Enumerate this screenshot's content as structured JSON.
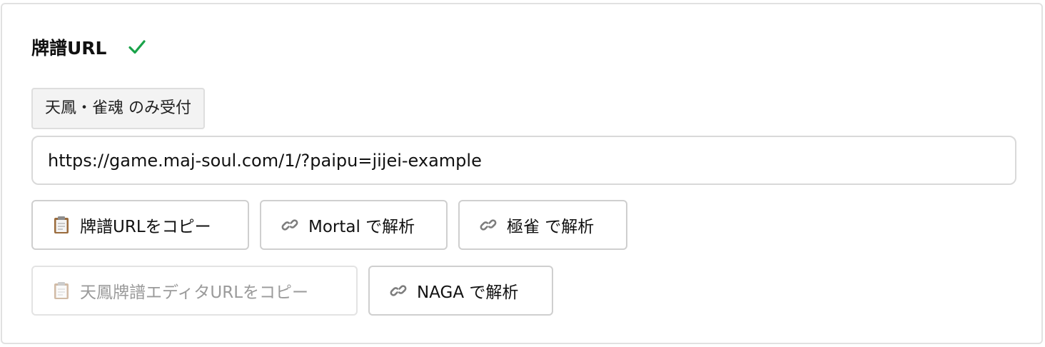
{
  "header": {
    "title": "牌譜URL",
    "valid_icon": "check-icon",
    "valid_color": "#1aa34a"
  },
  "badge": {
    "label": "天鳳・雀魂 のみ受付"
  },
  "url_field": {
    "value": "https://game.maj-soul.com/1/?paipu=jijei-example"
  },
  "actions": {
    "copy_url": {
      "icon": "clipboard-icon",
      "label": "牌譜URLをコピー"
    },
    "mortal": {
      "icon": "link-icon",
      "label": "Mortal で解析"
    },
    "jantama": {
      "icon": "link-icon",
      "label": "極雀 で解析"
    },
    "copy_tenhou_editor": {
      "icon": "clipboard-icon",
      "label": "天鳳牌譜エディタURLをコピー",
      "disabled": true
    },
    "naga": {
      "icon": "link-icon",
      "label": "NAGA で解析"
    }
  }
}
